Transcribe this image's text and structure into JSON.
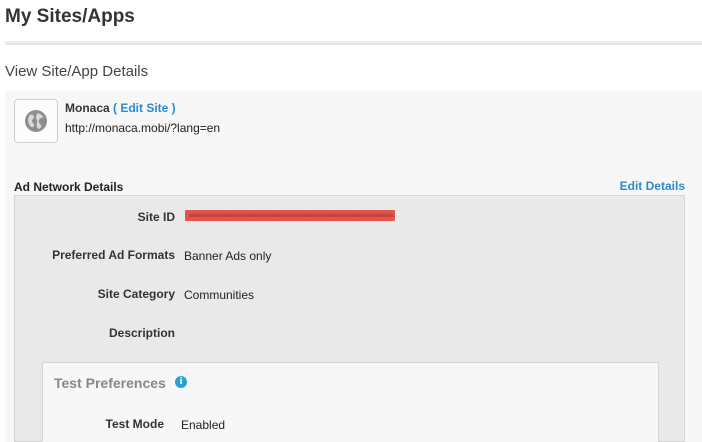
{
  "header": {
    "title": "My Sites/Apps"
  },
  "section": {
    "title": "View Site/App Details"
  },
  "site": {
    "name": "Monaca",
    "edit_label": "( Edit Site )",
    "url": "http://monaca.mobi/?lang=en",
    "icon": "globe-icon"
  },
  "ad_network": {
    "heading": "Ad Network Details",
    "edit_label": "Edit Details",
    "rows": [
      {
        "label": "Site ID",
        "value": "",
        "redacted": true
      },
      {
        "label": "Preferred Ad Formats",
        "value": "Banner Ads only"
      },
      {
        "label": "Site Category",
        "value": "Communities"
      },
      {
        "label": "Description",
        "value": ""
      }
    ]
  },
  "test_preferences": {
    "title": "Test Preferences",
    "info_icon": "info-icon",
    "rows": [
      {
        "label": "Test Mode",
        "value": "Enabled"
      }
    ]
  },
  "colors": {
    "link": "#2a8bd1",
    "redaction": "#e0554d",
    "info": "#2aa0d8"
  }
}
